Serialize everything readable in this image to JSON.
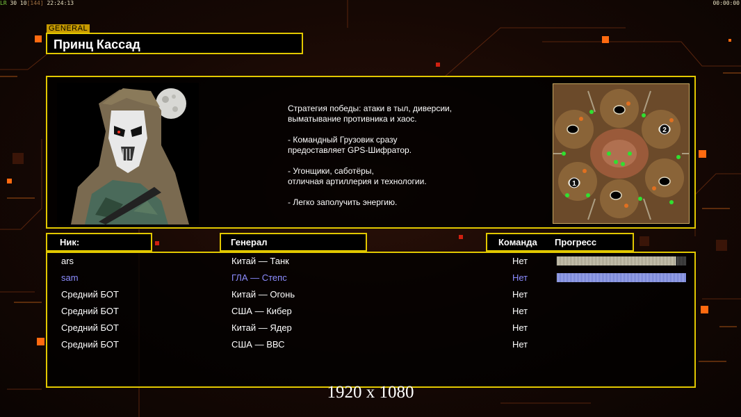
{
  "hud": {
    "fps_tag": "LR",
    "stats": "30 10",
    "stats_dim": "[144]",
    "time": "22:24:13",
    "clock": "00:00:00"
  },
  "general": {
    "tag": "GENERAL",
    "name": "Принц Кассад",
    "strategy": "Стратегия победы: атаки в тыл, диверсии,\n выматывание противника и хаос.\n\n- Командный Грузовик сразу\nпредоставляет GPS-Шифратор.\n\n- Угонщики, саботёры,\nотличная артиллерия и технологии.\n\n- Легко заполучить энергию."
  },
  "map": {
    "markers": [
      "1",
      "2"
    ]
  },
  "table": {
    "col_nick": "Ник:",
    "col_general": "Генерал",
    "col_team": "Команда",
    "col_progress": "Прогресс",
    "rows": [
      {
        "nick": "ars",
        "general": "Китай — Танк",
        "team": "Нет",
        "progress": 0.92,
        "color": "#ffffff",
        "bar": "white"
      },
      {
        "nick": "sam",
        "general": "ГЛА — Степс",
        "team": "Нет",
        "progress": 1.0,
        "color": "#8c8cff",
        "bar": "blue"
      },
      {
        "nick": "Средний БОТ",
        "general": "Китай — Огонь",
        "team": "Нет",
        "progress": null,
        "color": "#ffffff"
      },
      {
        "nick": "Средний БОТ",
        "general": "США — Кибер",
        "team": "Нет",
        "progress": null,
        "color": "#ffffff"
      },
      {
        "nick": "Средний БОТ",
        "general": "Китай — Ядер",
        "team": "Нет",
        "progress": null,
        "color": "#ffffff"
      },
      {
        "nick": "Средний БОТ",
        "general": "США — ВВС",
        "team": "Нет",
        "progress": null,
        "color": "#ffffff"
      }
    ]
  },
  "resolution": "1920 x 1080",
  "colors": {
    "accent": "#e2c800",
    "tag": "#c79a00",
    "glow": "#ff6a10"
  }
}
